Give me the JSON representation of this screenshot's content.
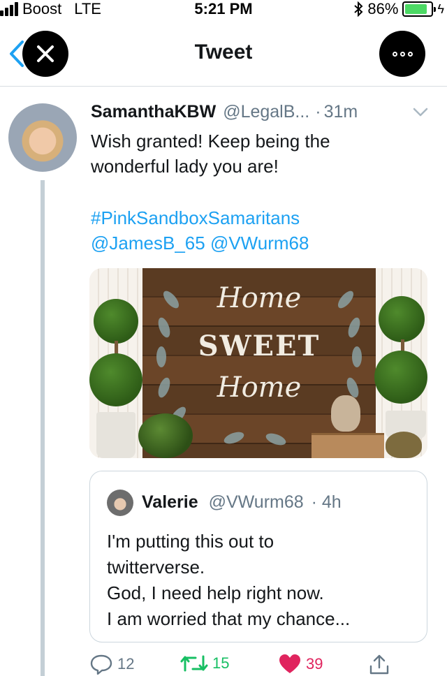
{
  "status_bar": {
    "carrier": "Boost",
    "network": "LTE",
    "time": "5:21 PM",
    "battery_percent": "86%",
    "battery_level": 0.86
  },
  "header": {
    "title": "Tweet"
  },
  "tweet": {
    "author_name": "SamanthaKBW",
    "author_handle": "@LegalB...",
    "dot": "·",
    "time": "31m",
    "text_lines": [
      "Wish granted!  Keep being the",
      "wonderful lady you are!"
    ],
    "hashtag": "#PinkSandboxSamaritans",
    "mentions": [
      "@JamesB_65",
      "@VWurm68"
    ],
    "image_sign": {
      "line1": "Home",
      "line2": "SWEET",
      "line3": "Home"
    }
  },
  "quoted_tweet": {
    "author_name": "Valerie",
    "author_handle": "@VWurm68",
    "time": "· 4h",
    "text_lines": [
      "I'm putting this out to",
      "twitterverse.",
      "God, I need help right now.",
      "I am worried that my chance..."
    ]
  },
  "actions": {
    "reply_count": "12",
    "retweet_count": "15",
    "like_count": "39"
  },
  "colors": {
    "link": "#1da1f2",
    "retweet": "#17bf63",
    "like": "#e0245e",
    "muted": "#657786",
    "battery": "#4cd964"
  }
}
